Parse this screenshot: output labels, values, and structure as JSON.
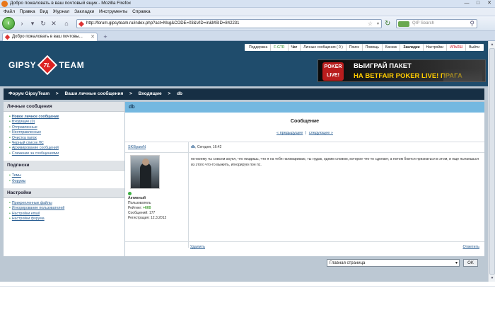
{
  "window": {
    "title": "Добро пожаловать в ваш почтовый ящик - Mozilla Firefox",
    "controls": [
      "—",
      "□",
      "✕"
    ]
  },
  "menu": [
    "Файл",
    "Правка",
    "Вид",
    "Журнал",
    "Закладки",
    "Инструменты",
    "Справка"
  ],
  "nav": {
    "url": "http://forum.gipsyteam.ru/index.php?act=Msg&CODE=03&VID=in&MSID=842231",
    "search_placeholder": "QIP Search"
  },
  "tab": {
    "label": "Добро пожаловать в ваш почтовы...",
    "new_tab": "+"
  },
  "site": {
    "topnav": [
      "Поддержка",
      "F-GTR",
      "Чат",
      "Личные сообщения (  0  )",
      "Поиск",
      "Помощь",
      "Бачник",
      "Закладки",
      "Настройки",
      "ИЛЬЯШ",
      "Выйти"
    ],
    "logo_left": "GIPSY",
    "logo_mark": "7L",
    "logo_right": "TEAM",
    "banner": {
      "badge1": "POKER",
      "badge2": "LIVE!",
      "line1": "ВЫИГРАЙ ПАКЕТ",
      "line2": "НА BETFAIR POKER LIVE! ПРАГА"
    }
  },
  "breadcrumbs": [
    "Форум GipsyTeam",
    ">",
    "Ваши личные сообщения",
    ">",
    "Входящие",
    ">",
    "db"
  ],
  "sidebar": {
    "sections": [
      {
        "title": "Личные сообщения",
        "items": [
          "Новое личное сообщение",
          "Входящие (0)",
          "Отправленные",
          "Неотправленные",
          "Очистка папок",
          "Черный список ЛС",
          "Архивирование сообщений",
          "Слежение за сообщениями"
        ]
      },
      {
        "title": "Подписки",
        "items": [
          "Темы",
          "Форумы"
        ]
      },
      {
        "title": "Настройки",
        "items": [
          "Прикрепленные файлы",
          "Игнорирование пользователей",
          "Настройки email",
          "Настройки форума"
        ]
      }
    ]
  },
  "message": {
    "header": "db",
    "title": "Сообщение",
    "nav_prev": "« предыдущее",
    "nav_sep": "|",
    "nav_next": "следующее »",
    "author": "SKBpawN",
    "meta_subject": "db",
    "meta_time": ", Сегодня, 16:42",
    "author_status": "Активный",
    "author_group": "Пользователь",
    "author_rep_label": "Рейтинг: ",
    "author_rep": "+600",
    "author_posts": "Сообщений: 177",
    "author_reg": "Регистрация: 12.3.2012",
    "text": "по-моему ты совсем ахуел, что пиздишь, что я на тебя наговариваю, ты нудак, одним словом, которое что-то сделает, а потом боится признаться в этом, и еще пытаешься из этого что-то выжить, игнорирую пон пс.",
    "delete": "Удалить",
    "reply": "Ответить"
  },
  "jump": {
    "selected": "Главная страница",
    "ok": "OK"
  }
}
